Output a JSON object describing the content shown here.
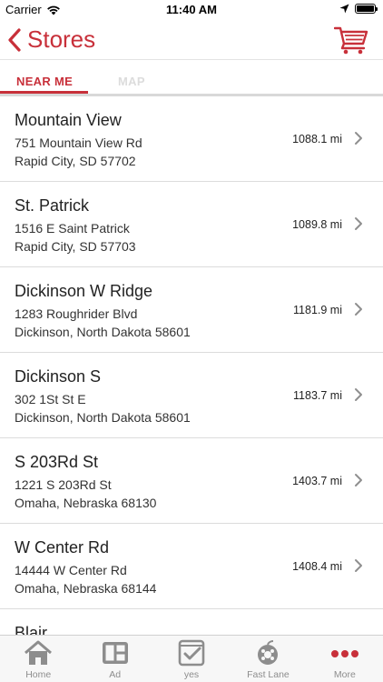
{
  "status_bar": {
    "carrier": "Carrier",
    "time": "11:40 AM"
  },
  "nav": {
    "title": "Stores",
    "back_icon": "chevron-left-icon",
    "cart_icon": "cart-icon"
  },
  "tabs": [
    {
      "label": "NEAR ME",
      "active": true
    },
    {
      "label": "MAP",
      "active": false
    }
  ],
  "stores": [
    {
      "name": "Mountain View",
      "address1": "751 Mountain View Rd",
      "address2": "Rapid City, SD 57702",
      "distance": "1088.1 mi"
    },
    {
      "name": "St. Patrick",
      "address1": "1516 E Saint Patrick",
      "address2": "Rapid City, SD 57703",
      "distance": "1089.8 mi"
    },
    {
      "name": "Dickinson W Ridge",
      "address1": "1283 Roughrider Blvd",
      "address2": "Dickinson, North Dakota 58601",
      "distance": "1181.9 mi"
    },
    {
      "name": "Dickinson S",
      "address1": "302 1St St E",
      "address2": "Dickinson, North Dakota 58601",
      "distance": "1183.7 mi"
    },
    {
      "name": "S 203Rd St",
      "address1": "1221 S 203Rd St",
      "address2": "Omaha, Nebraska 68130",
      "distance": "1403.7 mi"
    },
    {
      "name": "W Center Rd",
      "address1": "14444 W Center Rd",
      "address2": "Omaha, Nebraska 68144",
      "distance": "1408.4 mi"
    },
    {
      "name": "Blair",
      "address1": "",
      "address2": "",
      "distance": ""
    }
  ],
  "tab_bar": [
    {
      "label": "Home",
      "icon": "home-icon"
    },
    {
      "label": "Ad",
      "icon": "ad-icon"
    },
    {
      "label": "yes",
      "icon": "yes-basket-icon"
    },
    {
      "label": "Fast Lane",
      "icon": "fast-lane-icon"
    },
    {
      "label": "More",
      "icon": "more-icon"
    }
  ],
  "colors": {
    "accent": "#c8303a",
    "divider": "#dcdcdc",
    "tab_inactive": "#dcdcdc"
  }
}
